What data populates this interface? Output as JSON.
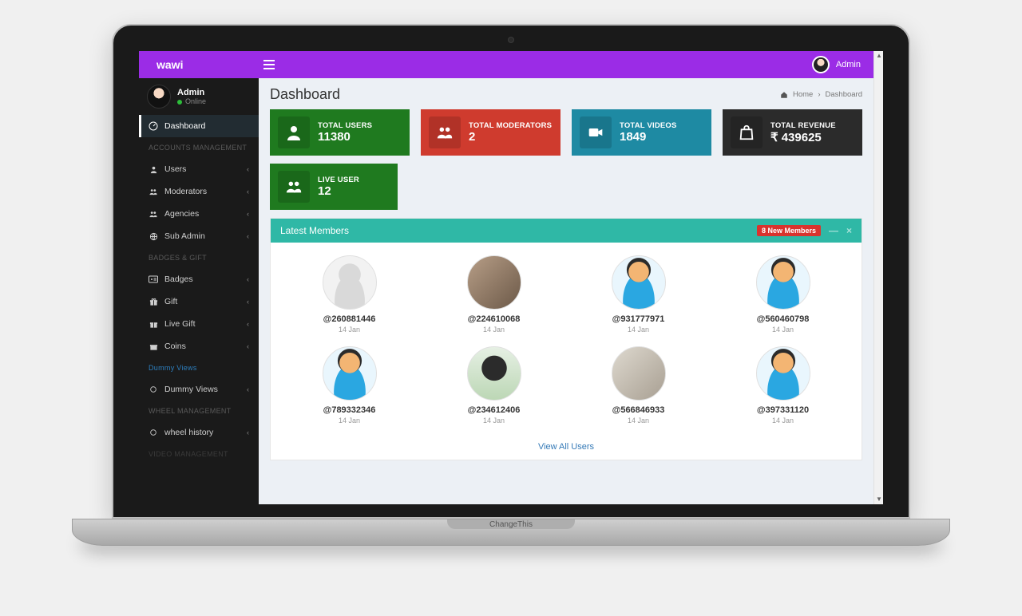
{
  "frame": {
    "hinge_text": "ChangeThis"
  },
  "header": {
    "brand": "wawi",
    "user_label": "Admin"
  },
  "sidebar": {
    "user": {
      "name": "Admin",
      "status_label": "Online"
    },
    "active_label": "Dashboard",
    "sections": {
      "accounts_header": "ACCOUNTS MANAGEMENT",
      "badges_header": "BADGES & GIFT",
      "dummy_header": "Dummy Views",
      "wheel_header": "WHEEL MANAGEMENT",
      "video_header": "VIDEO MANAGEMENT"
    },
    "items": {
      "users": "Users",
      "moderators": "Moderators",
      "agencies": "Agencies",
      "subadmin": "Sub Admin",
      "badges": "Badges",
      "gift": "Gift",
      "livegift": "Live Gift",
      "coins": "Coins",
      "dummyviews": "Dummy Views",
      "wheelhistory": "wheel history"
    }
  },
  "page": {
    "title": "Dashboard",
    "breadcrumb_home": "Home",
    "breadcrumb_current": "Dashboard"
  },
  "cards": {
    "total_users": {
      "label": "TOTAL USERS",
      "value": "11380"
    },
    "total_moderators": {
      "label": "TOTAL MODERATORS",
      "value": "2"
    },
    "total_videos": {
      "label": "TOTAL VIDEOS",
      "value": "1849"
    },
    "total_revenue": {
      "label": "TOTAL REVENUE",
      "value": "₹ 439625"
    },
    "live_user": {
      "label": "LIVE USER",
      "value": "12"
    }
  },
  "members_box": {
    "title": "Latest Members",
    "badge": "8 New Members",
    "view_all": "View All Users",
    "list": [
      {
        "handle": "@260881446",
        "date": "14 Jan",
        "avatar": "av-placeholder"
      },
      {
        "handle": "@224610068",
        "date": "14 Jan",
        "avatar": "av-photo1"
      },
      {
        "handle": "@931777971",
        "date": "14 Jan",
        "avatar": "av-cartoon"
      },
      {
        "handle": "@560460798",
        "date": "14 Jan",
        "avatar": "av-cartoon"
      },
      {
        "handle": "@789332346",
        "date": "14 Jan",
        "avatar": "av-cartoon"
      },
      {
        "handle": "@234612406",
        "date": "14 Jan",
        "avatar": "av-photo2"
      },
      {
        "handle": "@566846933",
        "date": "14 Jan",
        "avatar": "av-photo3"
      },
      {
        "handle": "@397331120",
        "date": "14 Jan",
        "avatar": "av-cartoon"
      }
    ]
  }
}
